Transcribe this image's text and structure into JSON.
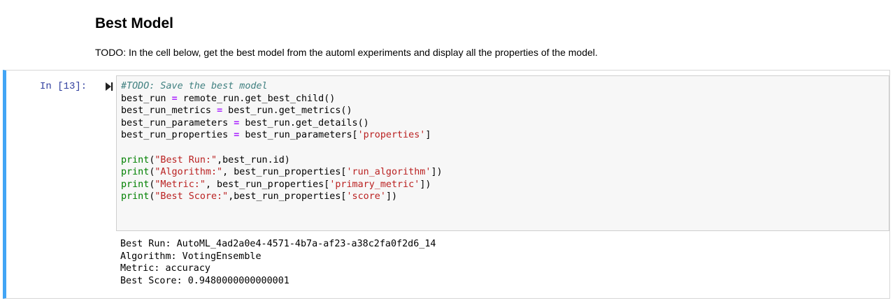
{
  "markdown": {
    "heading": "Best Model",
    "text": "TODO: In the cell below, get the best model from the automl experiments and display all the properties of the model."
  },
  "cell": {
    "prompt": "In [13]:",
    "run_icon": "run-step-icon",
    "code": {
      "comment": "#TODO: Save the best model",
      "l2_var": "best_run",
      "l2_eq": "=",
      "l2_rest": " remote_run.get_best_child()",
      "l3_var": "best_run_metrics",
      "l3_eq": "=",
      "l3_rest": " best_run.get_metrics()",
      "l4_var": "best_run_parameters",
      "l4_eq": "=",
      "l4_rest": " best_run.get_details()",
      "l5_var": "best_run_properties",
      "l5_eq": "=",
      "l5_mid": " best_run_parameters[",
      "l5_str": "'properties'",
      "l5_end": "]",
      "p1_fn": "print",
      "p1_open": "(",
      "p1_str": "\"Best Run:\"",
      "p1_rest": ",best_run.id)",
      "p2_fn": "print",
      "p2_open": "(",
      "p2_str": "\"Algorithm:\"",
      "p2_mid": ", best_run_properties[",
      "p2_key": "'run_algorithm'",
      "p2_end": "])",
      "p3_fn": "print",
      "p3_open": "(",
      "p3_str": "\"Metric:\"",
      "p3_mid": ", best_run_properties[",
      "p3_key": "'primary_metric'",
      "p3_end": "])",
      "p4_fn": "print",
      "p4_open": "(",
      "p4_str": "\"Best Score:\"",
      "p4_mid": ",best_run_properties[",
      "p4_key": "'score'",
      "p4_end": "])"
    },
    "output": [
      "Best Run: AutoML_4ad2a0e4-4571-4b7a-af23-a38c2fa0f2d6_14",
      "Algorithm: VotingEnsemble",
      "Metric: accuracy",
      "Best Score: 0.9480000000000001"
    ],
    "accent_color": "#42a5f5"
  }
}
